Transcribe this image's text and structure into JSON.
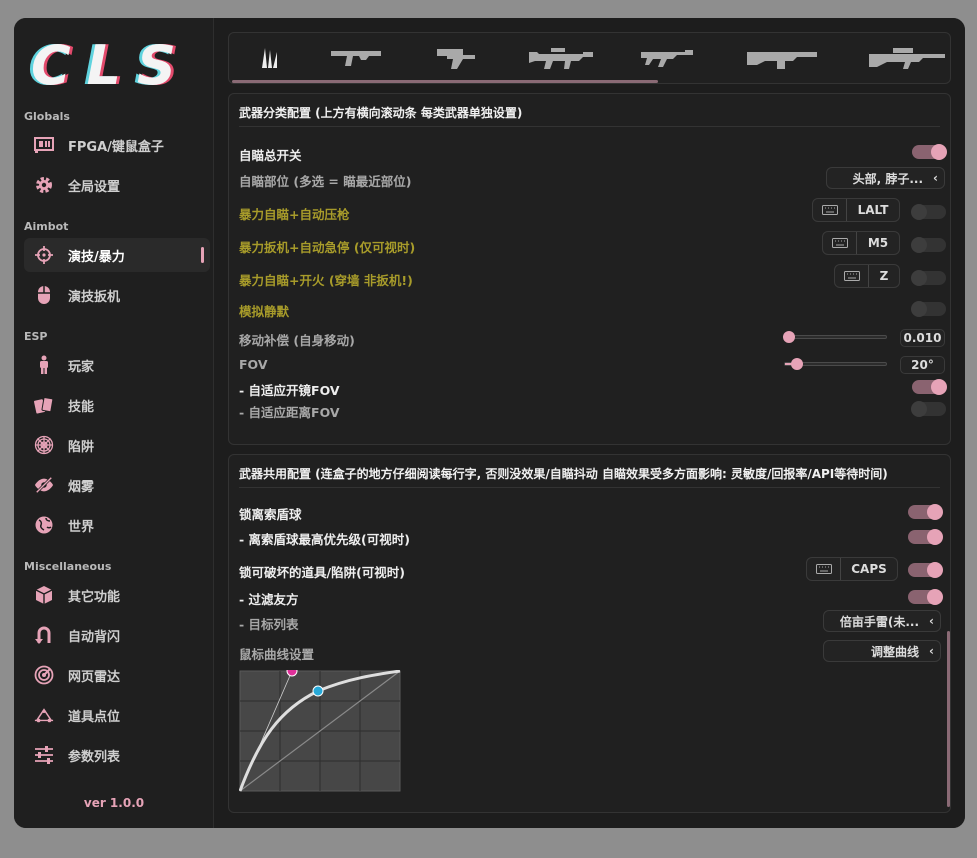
{
  "app": {
    "logo": "CLS",
    "version": "ver 1.0.0"
  },
  "colors": {
    "accent": "#e6a3b7",
    "yellow_label": "#a79b2a",
    "window_bg": "#1d1d1d"
  },
  "sidebar": {
    "sections": [
      {
        "title": "Globals",
        "items": [
          {
            "label": "FPGA/键鼠盒子",
            "icon": "fpga-card-icon"
          },
          {
            "label": "全局设置",
            "icon": "gear-icon"
          }
        ]
      },
      {
        "title": "Aimbot",
        "items": [
          {
            "label": "演技/暴力",
            "icon": "crosshair-icon",
            "active": true
          },
          {
            "label": "演技扳机",
            "icon": "mouse-icon"
          }
        ]
      },
      {
        "title": "ESP",
        "items": [
          {
            "label": "玩家",
            "icon": "person-icon"
          },
          {
            "label": "技能",
            "icon": "cards-icon"
          },
          {
            "label": "陷阱",
            "icon": "spiderweb-icon"
          },
          {
            "label": "烟雾",
            "icon": "eye-slash-icon"
          },
          {
            "label": "世界",
            "icon": "globe-icon"
          }
        ]
      },
      {
        "title": "Miscellaneous",
        "items": [
          {
            "label": "其它功能",
            "icon": "cube-icon"
          },
          {
            "label": "自动背闪",
            "icon": "u-turn-icon"
          },
          {
            "label": "网页雷达",
            "icon": "radar-icon"
          },
          {
            "label": "道具点位",
            "icon": "map-point-icon"
          },
          {
            "label": "参数列表",
            "icon": "sliders-icon"
          }
        ]
      }
    ]
  },
  "weapon_tabs": [
    "knife-icon",
    "pistol-icon",
    "revolver-icon",
    "smg-icon",
    "rifle-icon",
    "shotgun-icon",
    "sniper-icon"
  ],
  "panel1": {
    "title": "武器分类配置 (上方有横向滚动条 每类武器单独设置)",
    "rows": {
      "aim_master": "自瞄总开关",
      "aim_bone": "自瞄部位 (多选 = 瞄最近部位)",
      "aim_bone_value": "头部, 脖子...",
      "rage_aim": "暴力自瞄+自动压枪",
      "rage_aim_key": "LALT",
      "rage_trigger": "暴力扳机+自动急停 (仅可视时)",
      "rage_trigger_key": "M5",
      "rage_fire": "暴力自瞄+开火 (穿墙 非扳机!)",
      "rage_fire_key": "Z",
      "silent": "模拟静默",
      "move_comp": "移动补偿 (自身移动)",
      "move_comp_value": "0.010",
      "move_comp_level": 0.0,
      "fov": "FOV",
      "fov_value": "20°",
      "fov_level": 0.1,
      "adaptive_scope": "- 自适应开镜FOV",
      "adaptive_distance": "- 自适应距离FOV"
    }
  },
  "panel2": {
    "title": "武器共用配置 (连盒子的地方仔细阅读每行字, 否则没效果/自瞄抖动  自瞄效果受多方面影响: 灵敏度/回报率/API等待时间)",
    "rows": {
      "lock_shield": "锁离索盾球",
      "shield_priority": "- 离索盾球最高优先级(可视时)",
      "lock_props": "锁可破坏的道具/陷阱(可视时)",
      "lock_props_key": "CAPS",
      "filter_team": "- 过滤友方",
      "target_list": "- 目标列表",
      "target_list_value": "倍亩手雷(未...",
      "mouse_curve": "鼠标曲线设置",
      "curve_button": "调整曲线"
    }
  }
}
